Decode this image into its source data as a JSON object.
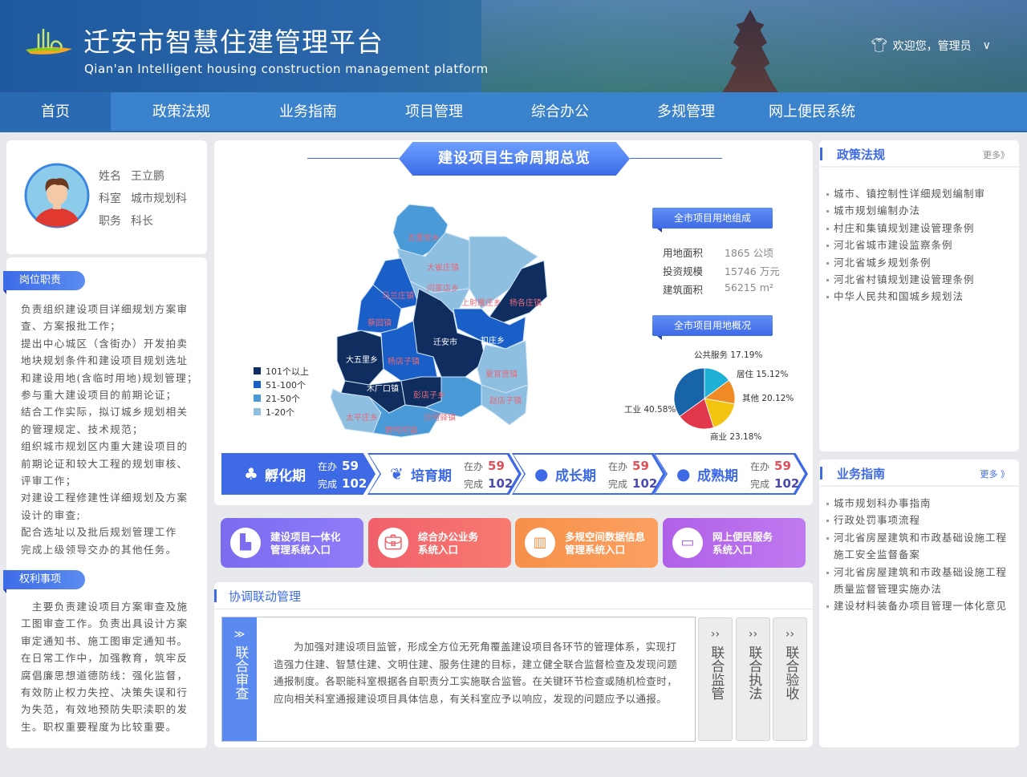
{
  "header": {
    "title": "迁安市智慧住建管理平台",
    "subtitle": "Qian'an Intelligent housing construction management platform",
    "welcome": "欢迎您，管理员"
  },
  "nav": [
    "首页",
    "政策法规",
    "业务指南",
    "项目管理",
    "综合办公",
    "多规管理",
    "网上便民系统"
  ],
  "profile": {
    "name_label": "姓名",
    "name": "王立鹏",
    "dept_label": "科室",
    "dept": "城市规划科",
    "title_label": "职务",
    "title": "科长"
  },
  "duties": {
    "label": "岗位职责",
    "text": "负责组织建设项目详细规划方案审查、方案报批工作；\n提出中心城区（含街办）开发拍卖地块规划条件和建设项目规划选址和建设用地(含临时用地)规划管理；\n参与重大建设项目的前期论证；\n结合工作实际，拟订城乡规划相关的管理规定、技术规范；\n组织城市规划区内重大建设项目的前期论证和较大工程的规划审核、评审工作；\n对建设工程修建性详细规划及方案设计的审查;\n配合选址以及批后规划管理工作\n完成上级领导交办的其他任务。"
  },
  "rights": {
    "label": "权利事项",
    "text": "　主要负责建设项目方案审查及施工图审查工作。负责出具设计方案审定通知书、施工图审定通知书。在日常工作中，加强教育，筑牢反腐倡廉思想道德防线：强化监督，有效防止权力失控、决策失误和行为失范，有效地预防失职渎职的发生。职权重要程度为比较重要。"
  },
  "lifecycle": {
    "title": "建设项目生命周期总览",
    "map_legend": [
      "101个以上",
      "51-100个",
      "21-50个",
      "1-20个"
    ],
    "regions": [
      {
        "name": "五重安乡",
        "level": 2
      },
      {
        "name": "大崔庄镇",
        "level": 3
      },
      {
        "name": "闫家店乡",
        "level": 3
      },
      {
        "name": "上射雁庄乡",
        "level": 3
      },
      {
        "name": "杨各庄镇",
        "level": 0
      },
      {
        "name": "马兰庄镇",
        "level": 1
      },
      {
        "name": "蔡园镇",
        "level": 1
      },
      {
        "name": "迁安市",
        "level": 0
      },
      {
        "name": "扣庄乡",
        "level": 1
      },
      {
        "name": "夏官营镇",
        "level": 3
      },
      {
        "name": "赵店子镇",
        "level": 3
      },
      {
        "name": "大五里乡",
        "level": 0
      },
      {
        "name": "杨店子镇",
        "level": 1
      },
      {
        "name": "木厂口镇",
        "level": 0
      },
      {
        "name": "彭店子乡",
        "level": 0
      },
      {
        "name": "沙河驿镇",
        "level": 2
      },
      {
        "name": "太平庄乡",
        "level": 3
      },
      {
        "name": "野鸡坨镇",
        "level": 2
      }
    ],
    "level_colors": [
      "#0f2d5e",
      "#1a5ec8",
      "#4a9ad8",
      "#8fbfe0"
    ],
    "composition": {
      "label": "全市项目用地组成",
      "rows": [
        {
          "k": "用地面积",
          "v": "1865 公顷"
        },
        {
          "k": "投资规模",
          "v": "15746 万元"
        },
        {
          "k": "建筑面积",
          "v": "56215 m²"
        }
      ]
    },
    "overview_label": "全市项目用地概况",
    "stages": [
      {
        "name": "孵化期",
        "doing_label": "在办",
        "doing": "59",
        "done_label": "完成",
        "done": "102"
      },
      {
        "name": "培育期",
        "doing_label": "在办",
        "doing": "59",
        "done_label": "完成",
        "done": "102"
      },
      {
        "name": "成长期",
        "doing_label": "在办",
        "doing": "59",
        "done_label": "完成",
        "done": "102"
      },
      {
        "name": "成熟期",
        "doing_label": "在办",
        "doing": "59",
        "done_label": "完成",
        "done": "102"
      }
    ]
  },
  "chart_data": {
    "type": "pie",
    "title": "全市项目用地概况",
    "labels": [
      "公共服务",
      "居住",
      "其他",
      "商业",
      "工业"
    ],
    "values": [
      17.19,
      15.12,
      20.12,
      23.18,
      40.58
    ],
    "display": [
      "公共服务 17.19%",
      "居住 15.12%",
      "其他 20.12%",
      "商业 23.18%",
      "工业 40.58%"
    ],
    "colors": [
      "#1fb0d6",
      "#f08a24",
      "#f2c40f",
      "#e0384a",
      "#1764a8"
    ]
  },
  "entries": [
    {
      "l1": "建设项目一体化",
      "l2": "管理系统入口"
    },
    {
      "l1": "综合办公业务",
      "l2": "系统入口"
    },
    {
      "l1": "多规空间数据信息",
      "l2": "管理系统入口"
    },
    {
      "l1": "网上便民服务",
      "l2": "系统入口"
    }
  ],
  "coordination": {
    "title": "协调联动管理",
    "active_tab": "联合审查",
    "text": "为加强对建设项目监管，形成全方位无死角覆盖建设项目各环节的管理体系，实现打造强力住建、智慧住建、文明住建、服务住建的目标，建立健全联合监督检查及发现问题通报制度。各职能科室根据各自职责分工实施联合监管。在关键环节检查或随机检查时，应向相关科室通报建设项目具体信息，有关科室应予以响应，发现的问题应予以通报。",
    "tabs": [
      "联合监管",
      "联合执法",
      "联合验收"
    ]
  },
  "policy": {
    "title": "政策法规",
    "more": "更多》",
    "items": [
      "城市、镇控制性详细规划编制审",
      "城市规划编制办法",
      "村庄和集镇规划建设管理条例",
      "河北省城市建设监察条例",
      "河北省城乡规划条例",
      "河北省村镇规划建设管理条例",
      "中华人民共和国城乡规划法"
    ]
  },
  "guide": {
    "title": "业务指南",
    "more": "更多 》",
    "items": [
      "城市规划科办事指南",
      "行政处罚事项流程",
      "河北省房屋建筑和市政基础设施工程施工安全监督备案",
      "河北省房屋建筑和市政基础设施工程质量监督管理实施办法",
      "建设材料装备办项目管理一体化意见"
    ]
  }
}
